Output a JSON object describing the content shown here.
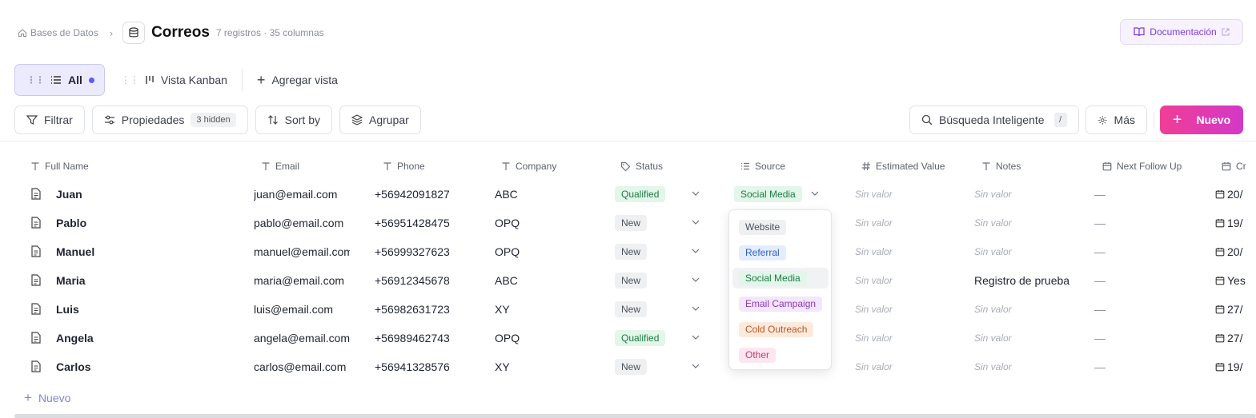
{
  "breadcrumb": {
    "home": "Bases de Datos",
    "title": "Correos",
    "meta": "7 registros · 35 columnas"
  },
  "doc_button": "Documentación",
  "views": [
    {
      "label": "All",
      "active": true
    },
    {
      "label": "Vista Kanban",
      "active": false
    },
    {
      "label": "Agregar vista",
      "active": false
    }
  ],
  "toolbar": {
    "filter": "Filtrar",
    "properties": "Propiedades",
    "hidden": "3 hidden",
    "sort": "Sort by",
    "group": "Agrupar",
    "search": "Búsqueda Inteligente",
    "search_key": "/",
    "more": "Más",
    "new": "Nuevo"
  },
  "columns": [
    "Full Name",
    "Email",
    "Phone",
    "Company",
    "Status",
    "Source",
    "Estimated Value",
    "Notes",
    "Next Follow Up",
    "Cr"
  ],
  "empty_value": "Sin valor",
  "dash": "—",
  "rows": [
    {
      "name": "Juan",
      "email": "juan@email.com",
      "phone": "+56942091827",
      "company": "ABC",
      "status": "Qualified",
      "source": "Social Media",
      "notes": "",
      "created": "20/"
    },
    {
      "name": "Pablo",
      "email": "pablo@email.com",
      "phone": "+56951428475",
      "company": "OPQ",
      "status": "New",
      "source": "",
      "notes": "",
      "created": "19/"
    },
    {
      "name": "Manuel",
      "email": "manuel@email.com",
      "phone": "+56999327623",
      "company": "OPQ",
      "status": "New",
      "source": "",
      "notes": "",
      "created": "20/"
    },
    {
      "name": "Maria",
      "email": "maria@email.com",
      "phone": "+56912345678",
      "company": "ABC",
      "status": "New",
      "source": "",
      "notes": "Registro de prueba",
      "created": "Yes"
    },
    {
      "name": "Luis",
      "email": "luis@email.com",
      "phone": "+56982631723",
      "company": "XY",
      "status": "New",
      "source": "",
      "notes": "",
      "created": "27/"
    },
    {
      "name": "Angela",
      "email": "angela@email.com",
      "phone": "+56989462743",
      "company": "OPQ",
      "status": "Qualified",
      "source": "",
      "notes": "",
      "created": "27/"
    },
    {
      "name": "Carlos",
      "email": "carlos@email.com",
      "phone": "+56941328576",
      "company": "XY",
      "status": "New",
      "source": "",
      "notes": "",
      "created": "19/"
    }
  ],
  "source_options": [
    {
      "label": "Website",
      "bg": "#eef0f2",
      "fg": "#4b515b"
    },
    {
      "label": "Referral",
      "bg": "#e3edfd",
      "fg": "#2f5fc4"
    },
    {
      "label": "Social Media",
      "bg": "#e2f6ea",
      "fg": "#1f7a44",
      "selected": true
    },
    {
      "label": "Email Campaign",
      "bg": "#f4e6fb",
      "fg": "#8a3bb5"
    },
    {
      "label": "Cold Outreach",
      "bg": "#fdeadd",
      "fg": "#b8561a"
    },
    {
      "label": "Other",
      "bg": "#fde6ef",
      "fg": "#c23b74"
    }
  ],
  "add_row": "Nuevo"
}
